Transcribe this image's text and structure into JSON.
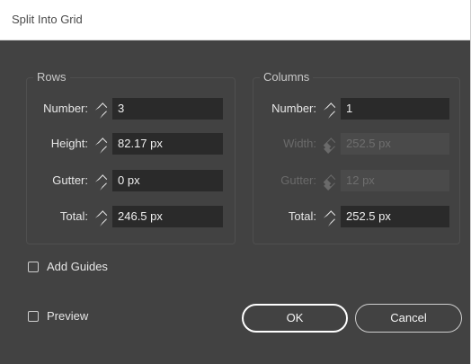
{
  "dialog": {
    "title": "Split Into Grid"
  },
  "rows": {
    "legend": "Rows",
    "number": {
      "label": "Number:",
      "value": "3"
    },
    "height": {
      "label": "Height:",
      "value": "82.17 px"
    },
    "gutter": {
      "label": "Gutter:",
      "value": "0 px"
    },
    "total": {
      "label": "Total:",
      "value": "246.5 px"
    }
  },
  "columns": {
    "legend": "Columns",
    "number": {
      "label": "Number:",
      "value": "1"
    },
    "width": {
      "label": "Width:",
      "value": "252.5 px",
      "disabled": true
    },
    "gutter": {
      "label": "Gutter:",
      "value": "12 px",
      "disabled": true
    },
    "total": {
      "label": "Total:",
      "value": "252.5 px"
    }
  },
  "options": {
    "add_guides": {
      "label": "Add Guides",
      "checked": false
    },
    "preview": {
      "label": "Preview",
      "checked": false
    }
  },
  "buttons": {
    "ok": "OK",
    "cancel": "Cancel"
  },
  "colors": {
    "dialog_bg": "#424242",
    "field_bg": "#2a2a2a",
    "text": "#e6e6e6"
  }
}
